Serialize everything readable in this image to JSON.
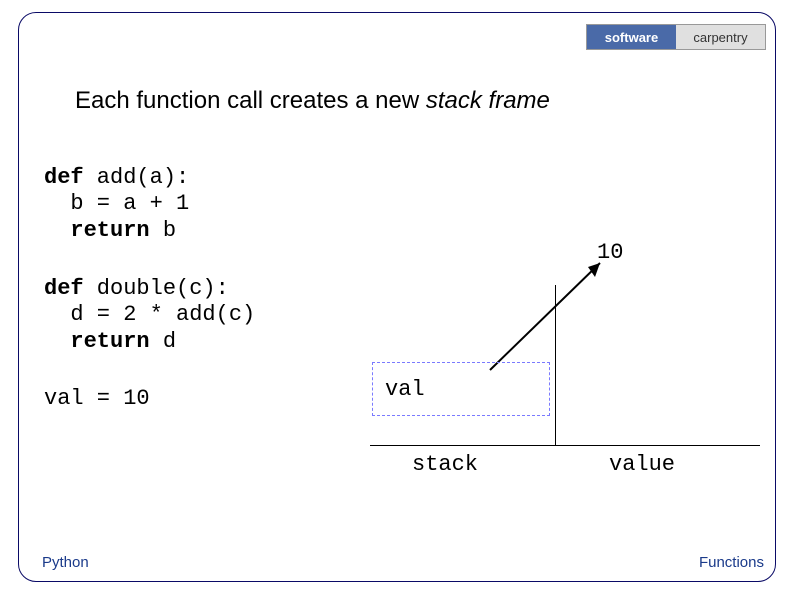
{
  "logo": {
    "left": "software",
    "right": "carpentry"
  },
  "title": {
    "prefix": "Each function call creates a new ",
    "italic": "stack frame"
  },
  "code": {
    "block1": {
      "l1a": "def",
      "l1b": " add(a):",
      "l2": "  b = a + 1",
      "l3a": "  ",
      "l3b": "return",
      "l3c": " b"
    },
    "block2": {
      "l1a": "def",
      "l1b": " double(c):",
      "l2": "  d = 2 * add(c)",
      "l3a": "  ",
      "l3b": "return",
      "l3c": " d"
    },
    "block3": {
      "l1": "val = 10"
    }
  },
  "diagram": {
    "value_number": "10",
    "box_label": "val",
    "stack_label": "stack",
    "value_label": "value"
  },
  "footer": {
    "left": "Python",
    "right": "Functions"
  }
}
